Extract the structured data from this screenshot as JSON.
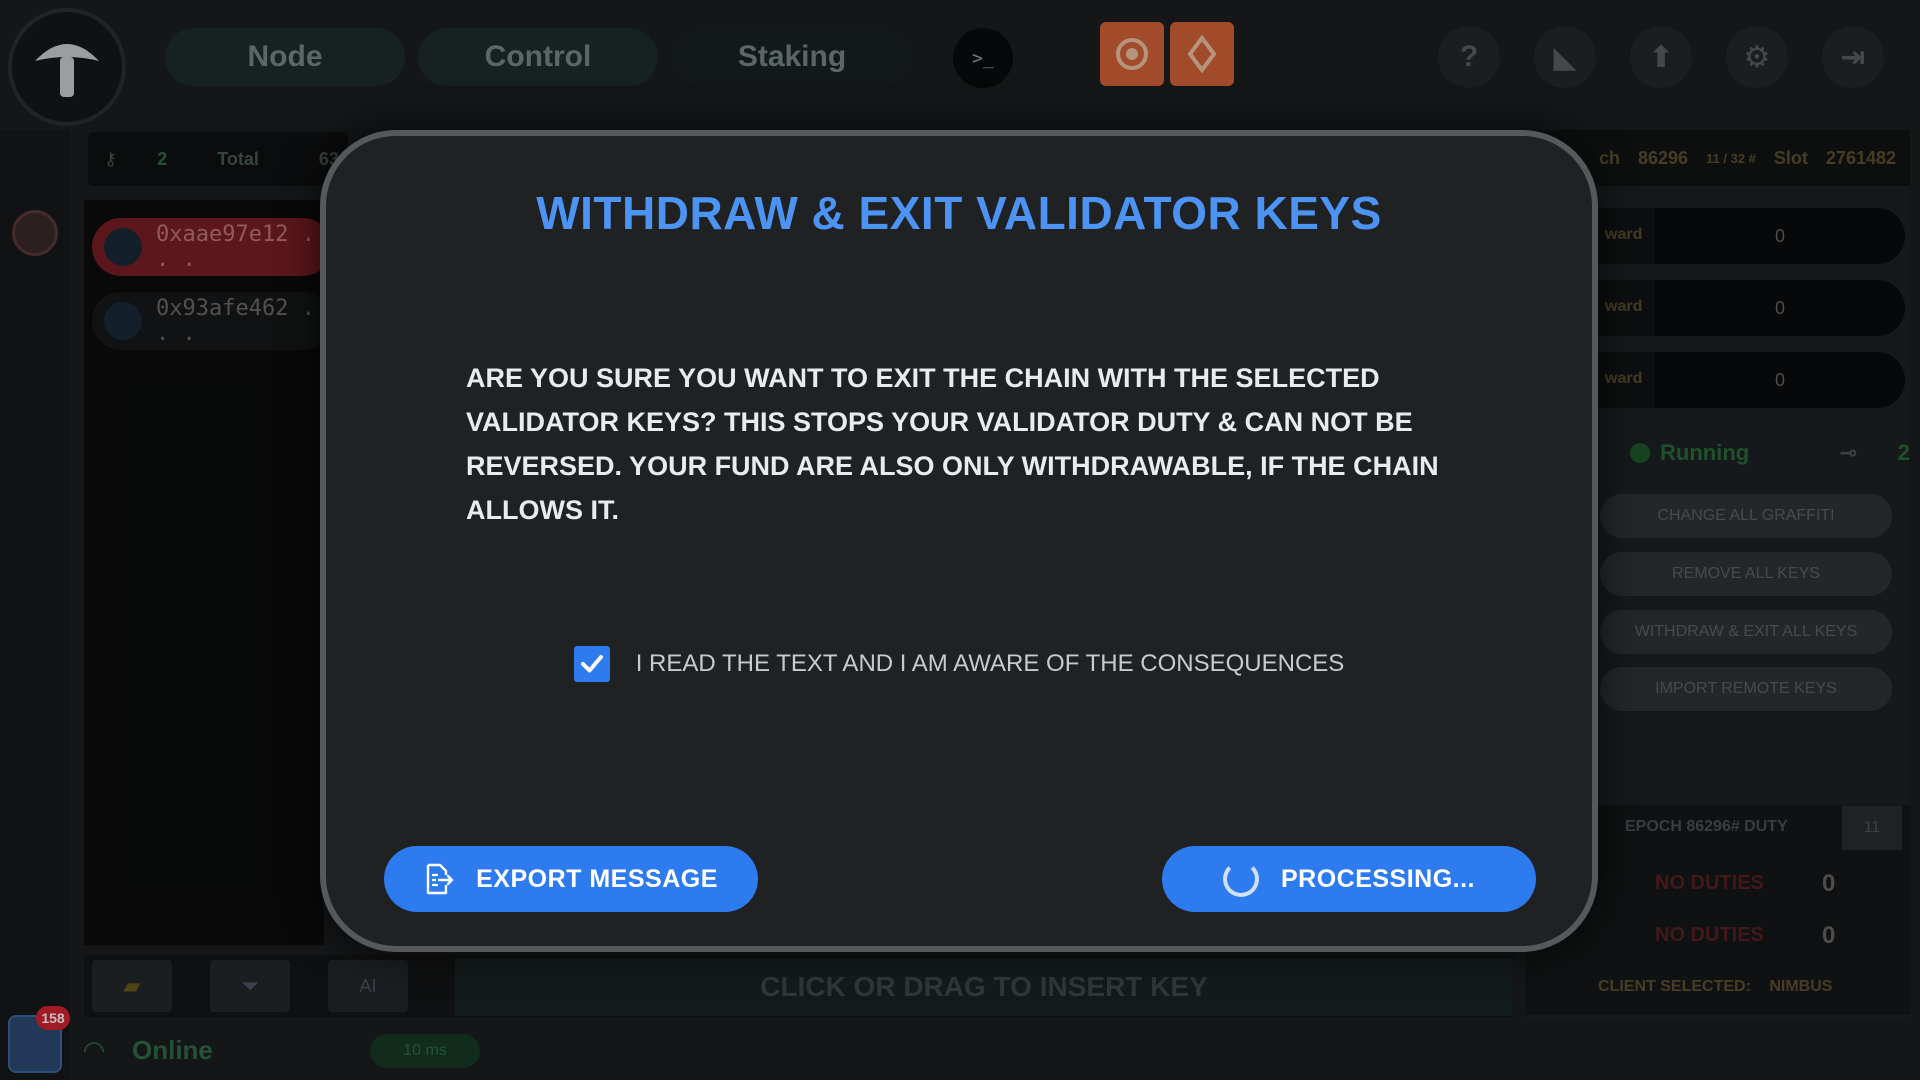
{
  "nav": {
    "node": "Node",
    "control": "Control",
    "staking": "Staking",
    "terminal": ">_"
  },
  "top_icons": {
    "help": "?"
  },
  "stats": {
    "key_count": "2",
    "total_label": "Total",
    "total_value": "63"
  },
  "keys": [
    {
      "address": "0xaae97e12 . . ."
    },
    {
      "address": "0x93afe462 . . ."
    }
  ],
  "epoch_bar": {
    "epoch_label": "ch",
    "epoch_value": "86296",
    "slot_fraction": "11 / 32 #",
    "slot_label": "Slot",
    "slot_value": "2761482"
  },
  "rewards": [
    {
      "label": "ward",
      "value": "0"
    },
    {
      "label": "ward",
      "value": "0"
    },
    {
      "label": "ward",
      "value": "0"
    }
  ],
  "status": {
    "running": "Running",
    "key_count": "2"
  },
  "actions": {
    "change_graffiti": "CHANGE ALL GRAFFITI",
    "remove_keys": "REMOVE ALL KEYS",
    "withdraw_exit": "WITHDRAW & EXIT ALL KEYS",
    "import_remote": "IMPORT REMOTE KEYS"
  },
  "duty": {
    "title": "EPOCH 86296# DUTY",
    "slot": "11",
    "rows": [
      {
        "label": "NO DUTIES",
        "count": "0"
      },
      {
        "label": "NO DUTIES",
        "count": "0"
      }
    ],
    "client_label": "CLIENT SELECTED:",
    "client_value": "NIMBUS"
  },
  "bottom": {
    "insert_text": "CLICK OR DRAG TO INSERT KEY",
    "online": "Online",
    "ping": "10 ms",
    "ai_label": "AI",
    "notifications": "158"
  },
  "modal": {
    "title": "WITHDRAW & EXIT VALIDATOR KEYS",
    "message": "ARE YOU SURE YOU WANT TO EXIT THE CHAIN WITH THE SELECTED VALIDATOR KEYS? THIS STOPS YOUR VALIDATOR DUTY & CAN NOT BE REVERSED. YOUR FUND ARE ALSO ONLY WITHDRAWABLE, IF THE CHAIN ALLOWS IT.",
    "checkbox_label": "I READ THE TEXT AND I AM AWARE OF THE CONSEQUENCES",
    "checkbox_checked": true,
    "export_label": "EXPORT MESSAGE",
    "processing_label": "PROCESSING..."
  },
  "colors": {
    "accent": "#2e7bf0",
    "title_blue": "#4c93f4",
    "danger": "#d9232f",
    "orange": "#d8643a"
  }
}
